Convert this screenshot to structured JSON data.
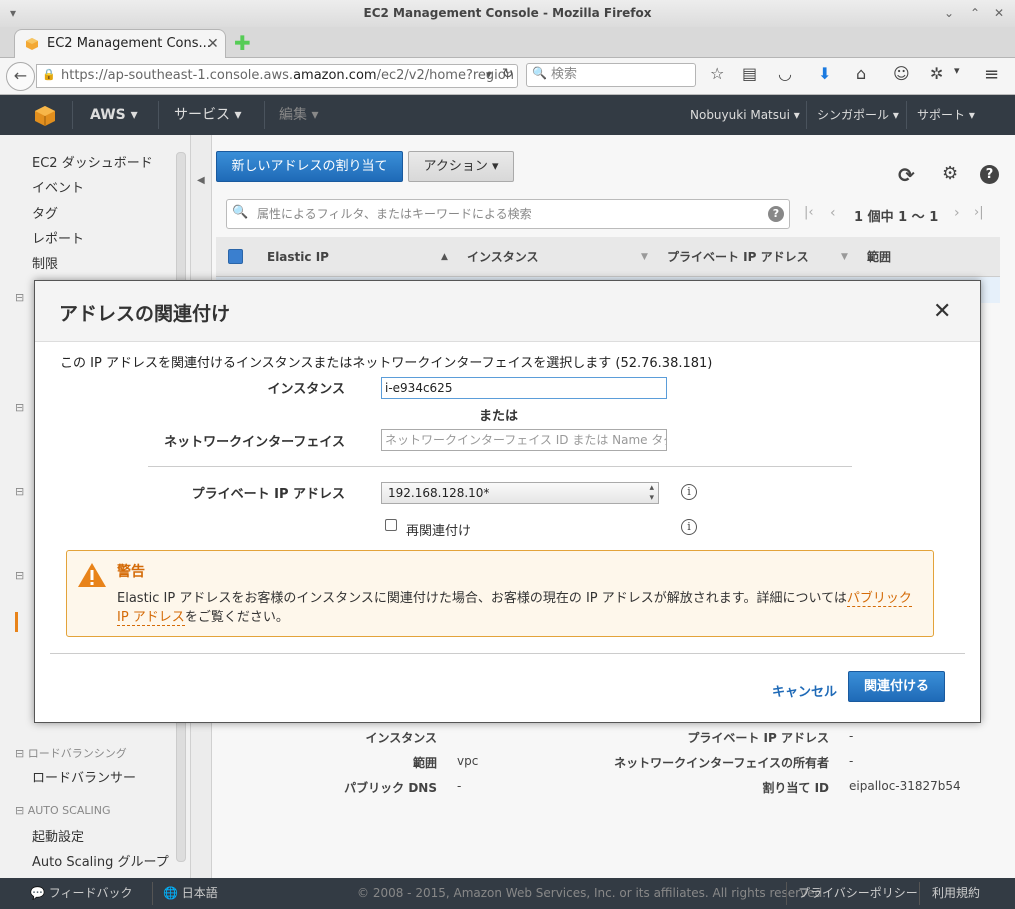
{
  "window": {
    "title": "EC2 Management Console - Mozilla Firefox"
  },
  "browser": {
    "tab_title": "EC2 Management Cons...",
    "url_prefix": "https://ap-southeast-1.console.aws.",
    "url_domain": "amazon.com",
    "url_suffix": "/ec2/v2/home?region",
    "search_placeholder": "検索"
  },
  "aws_header": {
    "aws": "AWS",
    "services": "サービス",
    "edit": "編集",
    "user": "Nobuyuki Matsui",
    "region": "シンガポール",
    "support": "サポート"
  },
  "sidebar": {
    "items": [
      "EC2 ダッシュボード",
      "イベント",
      "タグ",
      "レポート",
      "制限"
    ],
    "section_lb": "ロードバランシング",
    "lb_item": "ロードバランサー",
    "section_as": "AUTO SCALING",
    "as_items": [
      "起動設定",
      "Auto Scaling グループ"
    ]
  },
  "toolbar": {
    "allocate": "新しいアドレスの割り当て",
    "actions": "アクション",
    "filter_placeholder": "属性によるフィルタ、またはキーワードによる検索",
    "pagination": "1 個中 1 〜 1"
  },
  "table": {
    "headers": [
      "Elastic IP",
      "インスタンス",
      "プライベート IP アドレス",
      "範囲"
    ]
  },
  "details": {
    "left": [
      {
        "label": "インスタンス",
        "value": ""
      },
      {
        "label": "範囲",
        "value": "vpc"
      },
      {
        "label": "パブリック DNS",
        "value": "-"
      }
    ],
    "right": [
      {
        "label": "プライベート IP アドレス",
        "value": "-"
      },
      {
        "label": "ネットワークインターフェイスの所有者",
        "value": "-"
      },
      {
        "label": "割り当て ID",
        "value": "eipalloc-31827b54"
      }
    ]
  },
  "modal": {
    "title": "アドレスの関連付け",
    "intro": "この IP アドレスを関連付けるインスタンスまたはネットワークインターフェイスを選択します (52.76.38.181)",
    "instance_label": "インスタンス",
    "instance_value": "i-e934c625",
    "or": "または",
    "eni_label": "ネットワークインターフェイス",
    "eni_placeholder": "ネットワークインターフェイス ID または Name タグの",
    "private_ip_label": "プライベート IP アドレス",
    "private_ip_value": "192.168.128.10*",
    "reassoc_label": "再関連付け",
    "warning_title": "警告",
    "warning_text": "Elastic IP アドレスをお客様のインスタンスに関連付けた場合、お客様の現在の IP アドレスが解放されます。詳細については",
    "warning_link": "パブリック IP アドレス",
    "warning_tail": "をご覧ください。",
    "cancel": "キャンセル",
    "associate": "関連付ける"
  },
  "footer": {
    "feedback": "フィードバック",
    "language": "日本語",
    "copyright": "© 2008 - 2015, Amazon Web Services, Inc. or its affiliates. All rights reserved.",
    "privacy": "プライバシーポリシー",
    "terms": "利用規約"
  },
  "colors": {
    "aws_dark": "#333b44",
    "primary_blue": "#1f6ab7",
    "warning_orange": "#d46b08"
  }
}
